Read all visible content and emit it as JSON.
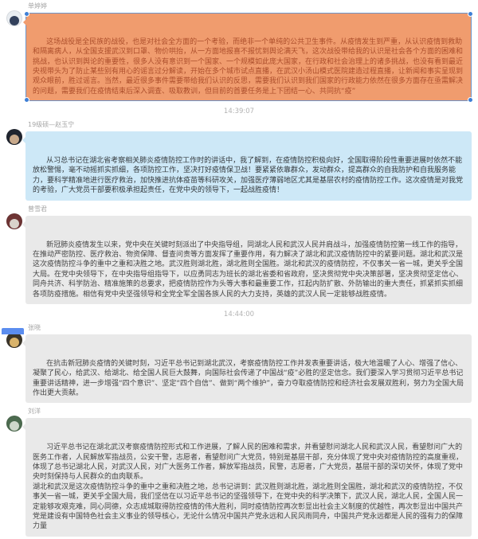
{
  "app": {
    "view": "group-chat-history"
  },
  "colors": {
    "background": "#FFFFFF",
    "highlight_bubble": "#F09C6E",
    "highlight_text": "#AC4E2B",
    "blue_bubble": "#CDE8F7",
    "gray_bubble": "#E9E9E9",
    "body_text": "#3D3D3D",
    "sender_text": "#A6A6A6",
    "timestamp_text": "#B3B3B3",
    "selection_handle": "#3E7FD6",
    "corner_badge": "#5B8DEF"
  },
  "feed": [
    {
      "kind": "message",
      "sender": "单婷婷",
      "variant": "orange",
      "selected": true,
      "avatar": [
        "#E9EDF1",
        "#33415C"
      ],
      "text": "这场战役是全民族的战役，也是对社会全方面的一个考验，而绝非一个单纯的公共卫生事件。从疫情发生到严重，从认识疫情到救助和隔离病人，从全国支援武汉到口罩、物价哄抬，从一方面地报喜不报忧到舆论满天飞，这次战役带给我的认识是社会各个方面的困难和挑战，也认识到舆论的重要性，很多人没有意识到一个国家、一个规模如此庞大国家，在行政和社会治理上的诸多挑战，也没有看到最近央视带头为了防止某些别有用心的谣言过分解读，开始在多个城市试点直播，在武汉小汤山模式医院建造过程直播，让新闻和事实呈现到观众眼前，胜过谣言。当然，最近很多事件需要带给我们认识的反思，需要我们认识到我们国家的行政能力依然在很多方面存在亟需解决的问题，需要我们在疫情结束后深入调查、吸取教训，但目前的首要任务是上下团结一心、共同抗“疫”"
    },
    {
      "kind": "time",
      "label": "14:39:07"
    },
    {
      "kind": "message",
      "sender": "19级硕—赵玉宁",
      "variant": "blue",
      "selected": false,
      "avatar": [
        "#20252F",
        "#C8A98B"
      ],
      "text": "从习总书记在湖北省考察相关肺炎疫情防控工作时的讲话中，我了解到，在疫情防控积极向好，全国取得阶段性重要进展时依然不能放松警惕，毫不动摇抓实抓细，各项防控工作，坚决打好疫情保卫战！要紧紧依靠群众，发动群众，提高群众的自我防护和自我服务能力，要科学精准地进行医疗救治，加快推进抗体疫苗等科研攻关，加强医疗薄弱地区尤其是基层农村的疫情防控工作。这次疫情是对我党的考验，广大党员干部要积极承担起责任，在党中央的领导下，一起战胜疫情！"
    },
    {
      "kind": "message",
      "sender": "曾雪君",
      "variant": "gray",
      "selected": false,
      "avatar": [
        "#6E3434",
        "#D9D3CB"
      ],
      "text": "新冠肺炎疫情发生以来，党中央在关键时刻派出了中央指导组，同湖北人民和武汉人民并肩战斗，加强疫情防控第一线工作的指导，在推动严密防控、医疗救治、物资保障、督查问责等方面发挥了重要作用，有力解决了湖北和武汉疫情防控中的紧要问题。湖北和武汉是这次疫情防控斗争的重中之重和决胜之地。武汉胜则湖北胜，湖北胜则全国胜。湖北和武汉的疫情防控，不仅事关一省一城，更关乎全国大局。在党中央领导下，在中央指导组指导下，以应勇同志为班长的湖北省委和省政府，坚决贯彻党中央决策部署，坚决贯彻坚定信心、同舟共济、科学防治、精准施策的总要求，把疫情防控作为头等大事和最重要工作，扛起内防扩散、外防输出的重大责任，抓紧抓实抓细各项防疫措施。相信有党中央坚强领导和全党全军全国各族人民的大力支持，英雄的武汉人民一定能够战胜疫情。"
    },
    {
      "kind": "time",
      "label": "14:44:00"
    },
    {
      "kind": "message",
      "sender": "张晓",
      "variant": "gray",
      "selected": false,
      "avatar": [
        "#3B352A",
        "#D9B36B"
      ],
      "text": "在抗击新冠肺炎疫情的关键时刻，习近平总书记到湖北武汉，考察疫情防控工作并发表重要讲话，极大地温暖了人心、增强了信心、凝聚了民心，给武汉、给湖北、给全国人民巨大鼓舞，向国际社会传递了中国战“疫”必胜的坚定信念。我们要深入学习贯彻习近平总书记重要讲话精神，进一步增强“四个意识”、坚定“四个自信”、做到“两个维护”，奋力夺取疫情防控和经济社会发展双胜利，努力为全国大局作出更大贡献。"
    },
    {
      "kind": "message",
      "sender": "刘洋",
      "variant": "gray",
      "selected": false,
      "avatar": [
        "#4C6B4F",
        "#CFD8CB"
      ],
      "text": "习近平总书记在湖北武汉考察疫情防控形式和工作进展，了解人民的困难和需求，并看望慰问湖北人民和武汉人民，看望慰问广大的医务工作者，人民解放军指战员，公安干警，志愿者，看望慰问广大党员，特别是基层干部，充分体现了党中央对疫情防控的高度重视，体现了总书记湖北人民，对武汉人民，对广大医务工作者，解放军指战员，民警，志愿者，广大党员，基层干部的深切关怀，体现了党中央时刻保持与人民群众的血肉联系。\n湖北和武汉是这次疫情防控斗争的重中之重和决胜之地，总书记讲到：武汉胜则湖北胜，湖北胜则全国胜，湖北和武汉的疫情防控，不仅事关一省一城，更关乎全国大局，我们坚信在以习近平总书记的坚强领导下，在党中央的科学决策下，武汉人民，湖北人民，全国人民一定能够攻艰克难，同心同德，众志成城取得防控疫情的伟大胜利，同时疫情防控再次彰显出社会主义制度的优越性，再次彰显出中国共产党是建设有中国特色社会主义事业的领导核心，无论什么情况中国共产党永远和人民风雨同舟，中国共产党永远都是人民的强有力的保障力量"
    }
  ]
}
